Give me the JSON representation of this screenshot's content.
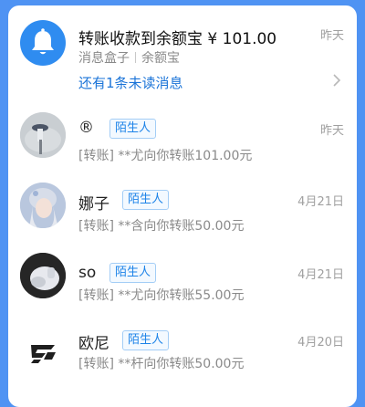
{
  "notice": {
    "title": "转账收款到余额宝 ¥ 101.00",
    "date": "昨天",
    "source": "消息盒子",
    "tag": "余额宝",
    "unread": "还有1条未读消息",
    "icon": "bell-icon",
    "color": "#2f8cf0"
  },
  "messages": [
    {
      "name": "®",
      "badge": "陌生人",
      "date": "昨天",
      "preview": "[转账] **尤向你转账101.00元",
      "avatar": "avatar-1"
    },
    {
      "name": "娜子",
      "badge": "陌生人",
      "date": "4月21日",
      "preview": "[转账] **含向你转账50.00元",
      "avatar": "avatar-2"
    },
    {
      "name": "so",
      "badge": "陌生人",
      "date": "4月21日",
      "preview": "[转账] **尤向你转账55.00元",
      "avatar": "avatar-3"
    },
    {
      "name": "欧尼",
      "badge": "陌生人",
      "date": "4月20日",
      "preview": "[转账] **杆向你转账50.00元",
      "avatar": "avatar-4"
    }
  ]
}
